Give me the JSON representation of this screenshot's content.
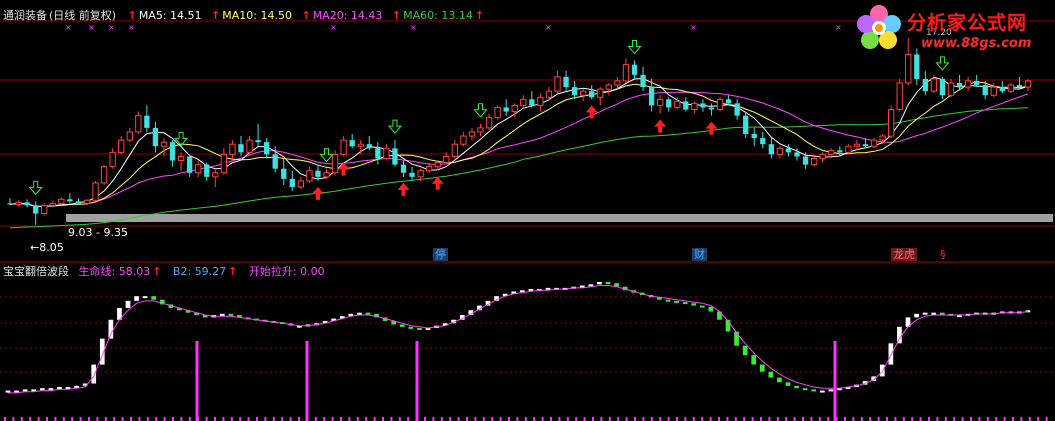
{
  "main_header": {
    "stock_name": "通润装备",
    "period": "(日线 前复权)",
    "ma5": "MA5: 14.51",
    "ma10": "MA10: 14.50",
    "ma20": "MA20: 14.43",
    "ma60": "MA60: 13.14",
    "up_glyph": "↑"
  },
  "sub_header": {
    "name": "宝宝翻倍波段",
    "life_line": "生命线: 58.03",
    "b2": "B2: 59.27",
    "start_pull": "开始拉升: 0.00",
    "up_glyph": "↑"
  },
  "annotations": {
    "range_label": "9.03 - 9.35",
    "low_label": "←8.05",
    "high_label": "17.20"
  },
  "event_labels": [
    {
      "text": "停",
      "color": "#4aa8ff",
      "bg": "#1a3f6a"
    },
    {
      "text": "财",
      "color": "#4aa8ff",
      "bg": "#1a3f6a"
    },
    {
      "text": "龙虎",
      "color": "#ff6a6a",
      "bg": "#6a1a1a"
    },
    {
      "text": "§",
      "color": "#ff2020",
      "bg": "transparent"
    }
  ],
  "logo": {
    "title": "分析家公式网",
    "url": "www.88gs.com"
  },
  "colors": {
    "up_candle": "#ff4040",
    "down_candle": "#40e0e0",
    "ma5": "#ffffff",
    "ma10": "#ffff66",
    "ma20": "#ff44ff",
    "ma60": "#33cc33",
    "osc_up": "#ffffff",
    "osc_down": "#33ee33",
    "life_line": "#ff44ff",
    "signal_bar": "#ff33ff",
    "grid": "#8b0000",
    "support_bar": "#a0a0a0"
  },
  "chart_data": {
    "type": "candlestick",
    "main": {
      "y_range": [
        7.5,
        17.5
      ],
      "candles": [
        [
          9.1,
          9.35,
          9.0,
          9.05
        ],
        [
          9.05,
          9.25,
          8.95,
          9.15
        ],
        [
          9.15,
          9.3,
          8.9,
          9.0
        ],
        [
          9.0,
          9.2,
          8.05,
          8.6
        ],
        [
          8.6,
          9.1,
          8.5,
          9.0
        ],
        [
          9.0,
          9.2,
          8.9,
          9.1
        ],
        [
          9.1,
          9.4,
          9.0,
          9.3
        ],
        [
          9.3,
          9.6,
          9.1,
          9.2
        ],
        [
          9.2,
          9.35,
          9.03,
          9.1
        ],
        [
          9.1,
          9.3,
          9.0,
          9.25
        ],
        [
          9.25,
          10.2,
          9.2,
          10.1
        ],
        [
          10.1,
          11.0,
          10.0,
          10.9
        ],
        [
          10.9,
          11.8,
          10.8,
          11.6
        ],
        [
          11.6,
          12.4,
          11.5,
          12.2
        ],
        [
          12.2,
          12.8,
          12.1,
          12.6
        ],
        [
          12.6,
          13.6,
          12.5,
          13.4
        ],
        [
          13.4,
          13.9,
          12.6,
          12.8
        ],
        [
          12.8,
          13.1,
          11.6,
          11.9
        ],
        [
          11.9,
          12.3,
          11.4,
          12.1
        ],
        [
          12.1,
          12.2,
          10.9,
          11.2
        ],
        [
          11.2,
          11.6,
          10.7,
          11.4
        ],
        [
          11.4,
          11.5,
          10.4,
          10.6
        ],
        [
          10.6,
          11.2,
          10.4,
          11.0
        ],
        [
          11.0,
          11.1,
          10.2,
          10.4
        ],
        [
          10.4,
          10.8,
          9.9,
          10.6
        ],
        [
          10.6,
          11.8,
          10.5,
          11.5
        ],
        [
          11.5,
          12.2,
          11.3,
          12.0
        ],
        [
          12.0,
          12.4,
          11.4,
          11.6
        ],
        [
          11.6,
          12.4,
          11.5,
          12.2
        ],
        [
          12.2,
          13.0,
          11.9,
          12.1
        ],
        [
          12.1,
          12.3,
          11.3,
          11.5
        ],
        [
          11.5,
          11.9,
          10.6,
          10.8
        ],
        [
          10.8,
          11.3,
          10.0,
          10.3
        ],
        [
          10.3,
          10.7,
          9.7,
          9.9
        ],
        [
          9.9,
          10.4,
          9.8,
          10.2
        ],
        [
          10.2,
          10.9,
          10.1,
          10.7
        ],
        [
          10.7,
          11.0,
          10.2,
          10.4
        ],
        [
          10.4,
          10.8,
          10.3,
          10.6
        ],
        [
          10.6,
          11.7,
          10.5,
          11.5
        ],
        [
          11.5,
          12.4,
          11.4,
          12.2
        ],
        [
          12.2,
          12.5,
          11.8,
          11.9
        ],
        [
          11.9,
          12.2,
          11.5,
          12.0
        ],
        [
          12.0,
          12.4,
          11.7,
          11.8
        ],
        [
          11.8,
          12.1,
          11.0,
          11.3
        ],
        [
          11.3,
          12.0,
          11.2,
          11.8
        ],
        [
          11.8,
          12.2,
          10.9,
          11.0
        ],
        [
          11.0,
          11.2,
          10.4,
          10.6
        ],
        [
          10.6,
          10.9,
          10.2,
          10.4
        ],
        [
          10.4,
          10.8,
          10.2,
          10.7
        ],
        [
          10.7,
          11.1,
          10.6,
          10.9
        ],
        [
          10.9,
          11.2,
          10.7,
          11.1
        ],
        [
          11.1,
          11.6,
          11.0,
          11.4
        ],
        [
          11.4,
          12.2,
          11.3,
          12.0
        ],
        [
          12.0,
          12.6,
          11.9,
          12.4
        ],
        [
          12.4,
          12.8,
          12.2,
          12.6
        ],
        [
          12.6,
          13.0,
          12.4,
          12.8
        ],
        [
          12.8,
          13.5,
          12.7,
          13.3
        ],
        [
          13.3,
          13.9,
          13.2,
          13.8
        ],
        [
          13.8,
          14.2,
          13.4,
          13.6
        ],
        [
          13.6,
          14.0,
          13.3,
          13.9
        ],
        [
          13.9,
          14.4,
          13.7,
          14.2
        ],
        [
          14.2,
          14.6,
          13.8,
          13.9
        ],
        [
          13.9,
          14.5,
          13.6,
          14.3
        ],
        [
          14.3,
          14.8,
          14.1,
          14.6
        ],
        [
          14.6,
          15.6,
          14.5,
          15.3
        ],
        [
          15.3,
          15.6,
          14.6,
          14.8
        ],
        [
          14.8,
          15.1,
          14.2,
          14.4
        ],
        [
          14.4,
          14.7,
          14.1,
          14.6
        ],
        [
          14.6,
          14.9,
          14.2,
          14.3
        ],
        [
          14.3,
          14.8,
          13.9,
          14.7
        ],
        [
          14.7,
          15.0,
          14.4,
          14.9
        ],
        [
          14.9,
          15.3,
          14.7,
          15.1
        ],
        [
          15.1,
          16.2,
          15.0,
          15.9
        ],
        [
          15.9,
          16.1,
          15.2,
          15.4
        ],
        [
          15.4,
          15.8,
          14.6,
          14.8
        ],
        [
          14.8,
          15.2,
          13.6,
          13.9
        ],
        [
          13.9,
          14.4,
          13.5,
          14.2
        ],
        [
          14.2,
          14.3,
          13.6,
          13.8
        ],
        [
          13.8,
          14.3,
          13.7,
          14.1
        ],
        [
          14.1,
          14.3,
          13.6,
          13.7
        ],
        [
          13.7,
          14.1,
          13.5,
          14.0
        ],
        [
          14.0,
          14.2,
          13.6,
          13.8
        ],
        [
          13.8,
          14.0,
          13.4,
          13.7
        ],
        [
          13.7,
          14.3,
          13.6,
          14.2
        ],
        [
          14.2,
          14.4,
          13.9,
          14.0
        ],
        [
          14.0,
          14.2,
          13.2,
          13.4
        ],
        [
          13.4,
          13.6,
          12.3,
          12.5
        ],
        [
          12.5,
          12.8,
          11.9,
          12.3
        ],
        [
          12.3,
          12.6,
          11.8,
          12.0
        ],
        [
          12.0,
          12.3,
          11.3,
          11.5
        ],
        [
          11.5,
          11.9,
          11.3,
          11.8
        ],
        [
          11.8,
          12.0,
          11.4,
          11.6
        ],
        [
          11.6,
          11.8,
          11.2,
          11.4
        ],
        [
          11.4,
          11.6,
          10.8,
          11.0
        ],
        [
          11.0,
          11.4,
          10.9,
          11.3
        ],
        [
          11.3,
          11.6,
          11.1,
          11.5
        ],
        [
          11.5,
          11.8,
          11.3,
          11.7
        ],
        [
          11.7,
          11.9,
          11.4,
          11.6
        ],
        [
          11.6,
          12.0,
          11.5,
          11.9
        ],
        [
          11.9,
          12.2,
          11.7,
          12.0
        ],
        [
          12.0,
          12.3,
          11.8,
          11.9
        ],
        [
          11.9,
          12.3,
          11.8,
          12.2
        ],
        [
          12.2,
          12.5,
          12.0,
          12.4
        ],
        [
          12.4,
          13.9,
          12.3,
          13.7
        ],
        [
          13.7,
          15.2,
          13.6,
          15.0
        ],
        [
          15.0,
          17.2,
          14.9,
          16.4
        ],
        [
          16.4,
          16.7,
          14.9,
          15.2
        ],
        [
          15.2,
          15.6,
          14.4,
          14.6
        ],
        [
          14.6,
          15.4,
          14.5,
          15.2
        ],
        [
          15.2,
          15.3,
          14.2,
          14.4
        ],
        [
          14.4,
          15.2,
          14.3,
          15.0
        ],
        [
          15.0,
          15.4,
          14.7,
          14.8
        ],
        [
          14.8,
          15.3,
          14.6,
          15.1
        ],
        [
          15.1,
          15.4,
          14.8,
          14.9
        ],
        [
          14.9,
          15.1,
          14.2,
          14.4
        ],
        [
          14.4,
          15.0,
          14.3,
          14.8
        ],
        [
          14.8,
          15.1,
          14.5,
          14.6
        ],
        [
          14.6,
          15.0,
          14.5,
          14.9
        ],
        [
          14.9,
          15.3,
          14.7,
          14.8
        ],
        [
          14.8,
          15.2,
          14.6,
          15.1
        ]
      ],
      "buy_arrow_days": [
        36,
        39,
        46,
        50,
        68,
        76,
        82
      ],
      "sell_arrow_days": [
        3,
        20,
        37,
        45,
        55,
        73,
        109
      ],
      "ma60_start": 7.9
    },
    "oscillator": {
      "y_range": [
        0,
        100
      ],
      "values": [
        8,
        8,
        9,
        9,
        10,
        10,
        11,
        11,
        12,
        14,
        30,
        52,
        68,
        78,
        84,
        88,
        88,
        85,
        81,
        78,
        76,
        74,
        72,
        70,
        72,
        73,
        72,
        70,
        69,
        68,
        67,
        66,
        65,
        63,
        63,
        64,
        65,
        67,
        69,
        71,
        73,
        74,
        73,
        70,
        67,
        64,
        62,
        61,
        60,
        61,
        63,
        65,
        68,
        72,
        76,
        80,
        84,
        88,
        90,
        92,
        93,
        94,
        94,
        95,
        95,
        95,
        96,
        97,
        98,
        100,
        99,
        96,
        93,
        91,
        89,
        87,
        85,
        84,
        83,
        82,
        80,
        79,
        75,
        68,
        58,
        46,
        38,
        30,
        24,
        19,
        15,
        12,
        10,
        9,
        8,
        8,
        9,
        10,
        11,
        13,
        16,
        20,
        30,
        48,
        62,
        70,
        73,
        74,
        74,
        73,
        72,
        72,
        73,
        74,
        74,
        74,
        75,
        75,
        75,
        76
      ],
      "life_line": [
        6,
        6,
        7,
        7,
        8,
        8,
        9,
        9,
        10,
        11,
        20,
        38,
        56,
        68,
        76,
        82,
        84,
        84,
        82,
        80,
        78,
        76,
        74,
        72,
        71,
        71,
        71,
        70,
        69,
        68,
        67,
        66,
        65,
        64,
        63,
        63,
        64,
        65,
        67,
        69,
        71,
        72,
        72,
        71,
        69,
        67,
        65,
        63,
        62,
        61,
        62,
        63,
        66,
        69,
        73,
        77,
        81,
        85,
        88,
        90,
        91,
        92,
        93,
        93,
        94,
        94,
        95,
        95,
        96,
        97,
        97,
        96,
        94,
        92,
        90,
        88,
        87,
        86,
        85,
        84,
        83,
        82,
        80,
        75,
        67,
        57,
        48,
        40,
        33,
        27,
        22,
        18,
        15,
        13,
        11,
        10,
        10,
        10,
        11,
        12,
        14,
        17,
        24,
        38,
        52,
        62,
        68,
        71,
        72,
        72,
        72,
        72,
        72,
        73,
        73,
        73,
        74,
        74,
        74,
        75
      ],
      "signal_days": [
        29,
        46,
        63,
        125
      ]
    }
  }
}
